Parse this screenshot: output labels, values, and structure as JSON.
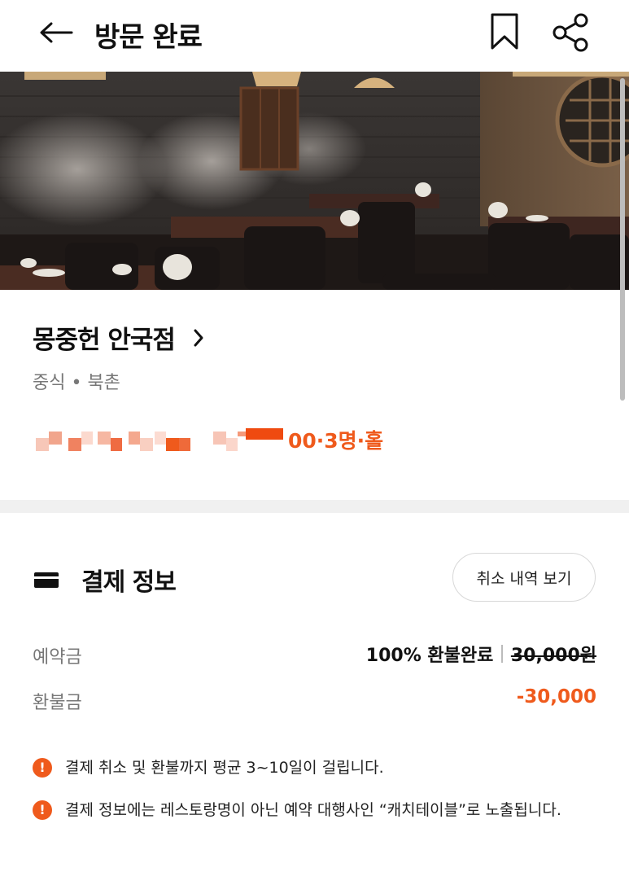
{
  "header": {
    "title": "방문 완료",
    "back_icon": "arrow-left-icon",
    "bookmark_icon": "bookmark-icon",
    "share_icon": "share-icon"
  },
  "restaurant": {
    "name": "몽중헌 안국점",
    "category_location": "중식 • 북촌",
    "reservation_suffix": "00·3명·홀"
  },
  "payment": {
    "title": "결제 정보",
    "cancel_history_label": "취소 내역 보기",
    "deposit_label": "예약금",
    "refund_status": "100% 환불완료",
    "original_price": "30,000원",
    "refund_label": "환불금",
    "refund_amount": "-30,000"
  },
  "notices": [
    "결제 취소 및 환불까지 평균 3~10일이 걸립니다.",
    "결제 정보에는 레스토랑명이 아닌 예약 대행사인 “캐치테이블”로 노출됩니다."
  ],
  "colors": {
    "accent": "#ef5a1c",
    "muted_text": "#777777",
    "divider": "#f0f0f0"
  }
}
